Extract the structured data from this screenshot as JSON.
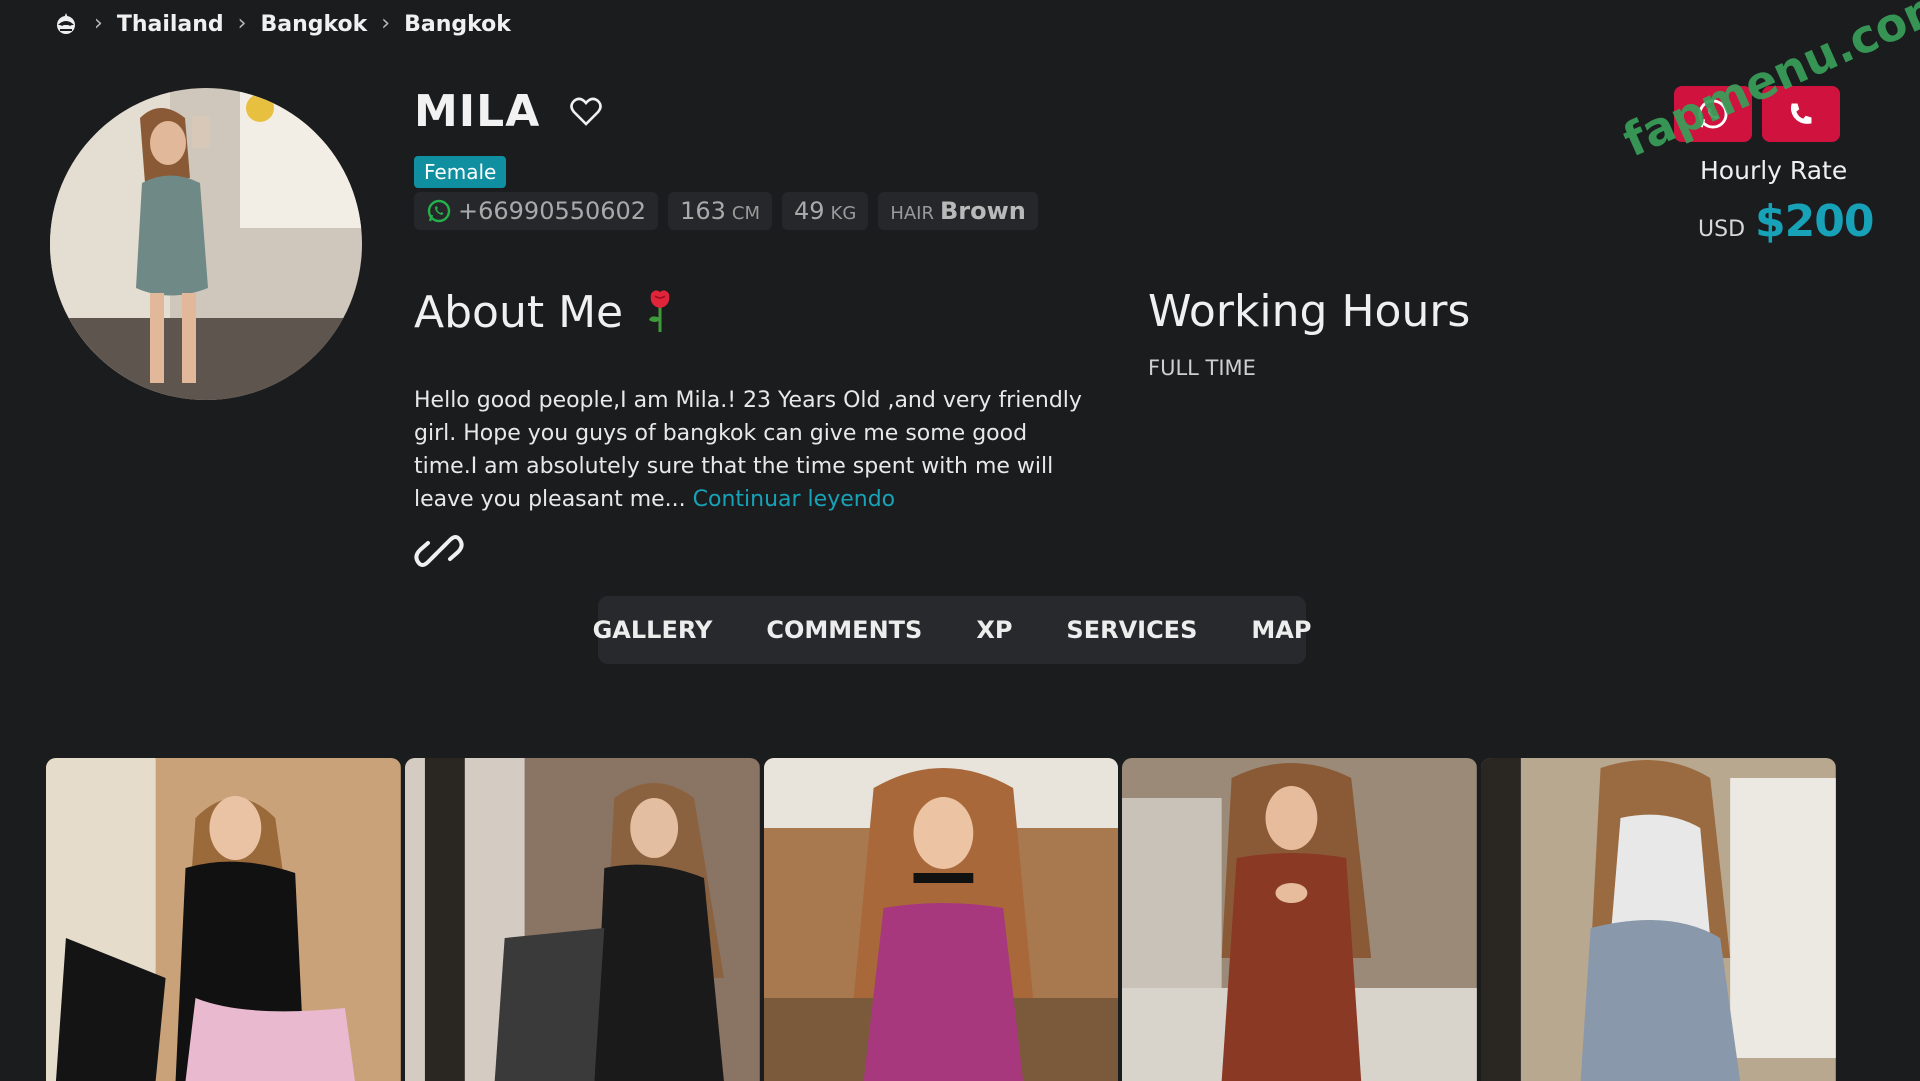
{
  "breadcrumb": {
    "items": [
      "Thailand",
      "Bangkok",
      "Bangkok"
    ]
  },
  "profile": {
    "name": "MILA",
    "gender": "Female",
    "phone": "+66990550602",
    "height_value": "163",
    "height_unit": "CM",
    "weight_value": "49",
    "weight_unit": "KG",
    "hair_label": "HAIR",
    "hair_value": "Brown"
  },
  "about": {
    "title": "About Me",
    "text": "Hello good people,I am Mila.! 23 Years Old ,and very friendly girl. Hope you guys of bangkok can give me some good time.I am absolutely sure that the time spent with me will leave you pleasant me...",
    "more_link": "Continuar leyendo"
  },
  "working_hours": {
    "title": "Working Hours",
    "value": "FULL TIME"
  },
  "rate": {
    "label": "Hourly Rate",
    "currency": "USD",
    "value": "$200"
  },
  "watermark": "fapmenu.com",
  "tabs": [
    "GALLERY",
    "COMMENTS",
    "XP",
    "SERVICES",
    "MAP"
  ],
  "gallery": {
    "photos": [
      {
        "top_color": "#c9a27a",
        "outfit": "#111111",
        "accent": "#e8b9cf"
      },
      {
        "top_color": "#8a7464",
        "outfit": "#1a1a1a",
        "accent": "#3a3a3a"
      },
      {
        "top_color": "#a8794f",
        "outfit": "#a8387e",
        "accent": "#7a5a3a"
      },
      {
        "top_color": "#9b8a78",
        "outfit": "#8a3a24",
        "accent": "#d8d4cc"
      },
      {
        "top_color": "#b8a890",
        "outfit": "#e8e8e8",
        "accent": "#8a98ac"
      }
    ]
  },
  "colors": {
    "accent": "#17a2b8",
    "danger": "#d0123f",
    "background": "#1b1c1e"
  }
}
